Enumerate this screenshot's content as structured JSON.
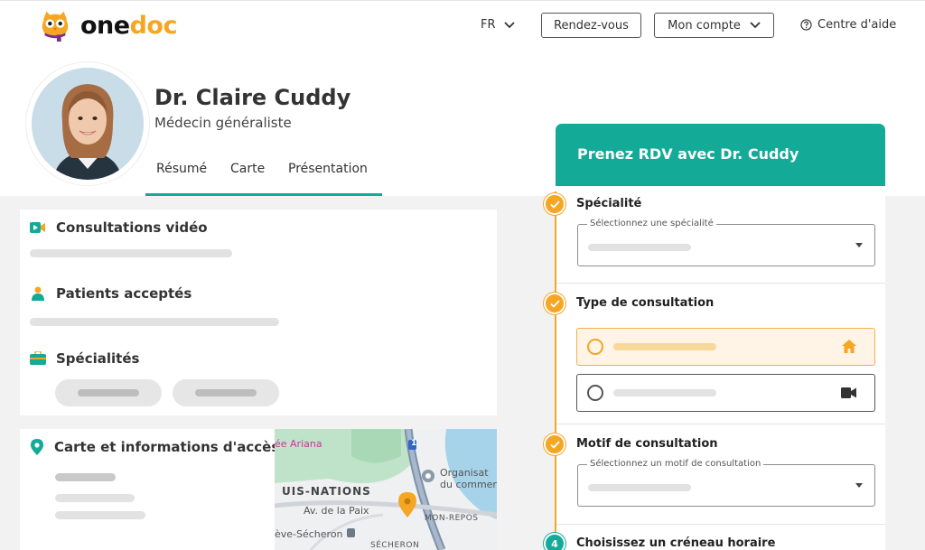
{
  "header": {
    "brand": {
      "part1": "one",
      "part2": "doc"
    },
    "language": "FR",
    "appointments_label": "Rendez-vous",
    "account_label": "Mon compte",
    "help_label": "Centre d'aide"
  },
  "profile": {
    "name": "Dr. Claire Cuddy",
    "role": "Médecin généraliste",
    "tabs": [
      "Résumé",
      "Carte",
      "Présentation"
    ]
  },
  "sections": {
    "video": "Consultations vidéo",
    "patients": "Patients acceptés",
    "specialties": "Spécialités",
    "map_info": "Carte et informations d'accès"
  },
  "map": {
    "labels": {
      "ariana": "ée Ariana",
      "organisation": "Organisat",
      "commerce": "du commer",
      "nations": "UIS-NATIONS",
      "paix": "Av. de la Paix",
      "monrepos": "MON-REPOS",
      "secheron_station": "ève-Sécheron",
      "secheron": "SÉCHERON",
      "line": "1"
    }
  },
  "booking": {
    "title": "Prenez RDV avec Dr. Cuddy",
    "steps": [
      {
        "title": "Spécialité",
        "field_label": "Sélectionnez une spécialité"
      },
      {
        "title": "Type de consultation"
      },
      {
        "title": "Motif de consultation",
        "field_label": "Sélectionnez un motif de consultation"
      },
      {
        "number": "4",
        "title": "Choisissez un créneau horaire"
      }
    ]
  },
  "colors": {
    "teal": "#13aa97",
    "orange": "#f5a623"
  }
}
